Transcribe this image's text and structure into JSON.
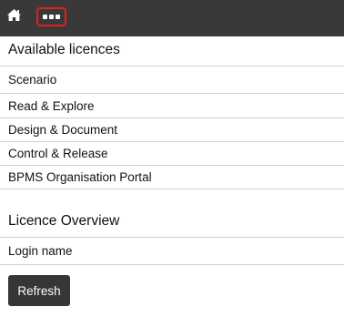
{
  "topbar": {
    "home_icon": "home-icon",
    "more_icon": "more-horizontal-icon",
    "colors": {
      "background": "#393939",
      "highlight_border": "#e02020"
    }
  },
  "licences": {
    "title": "Available licences",
    "items": [
      {
        "label": "Scenario"
      },
      {
        "label": "Read & Explore"
      },
      {
        "label": "Design & Document"
      },
      {
        "label": "Control & Release"
      },
      {
        "label": "BPMS Organisation Portal"
      }
    ]
  },
  "overview": {
    "title": "Licence Overview",
    "items": [
      {
        "label": "Login name"
      }
    ]
  },
  "actions": {
    "refresh_label": "Refresh"
  }
}
